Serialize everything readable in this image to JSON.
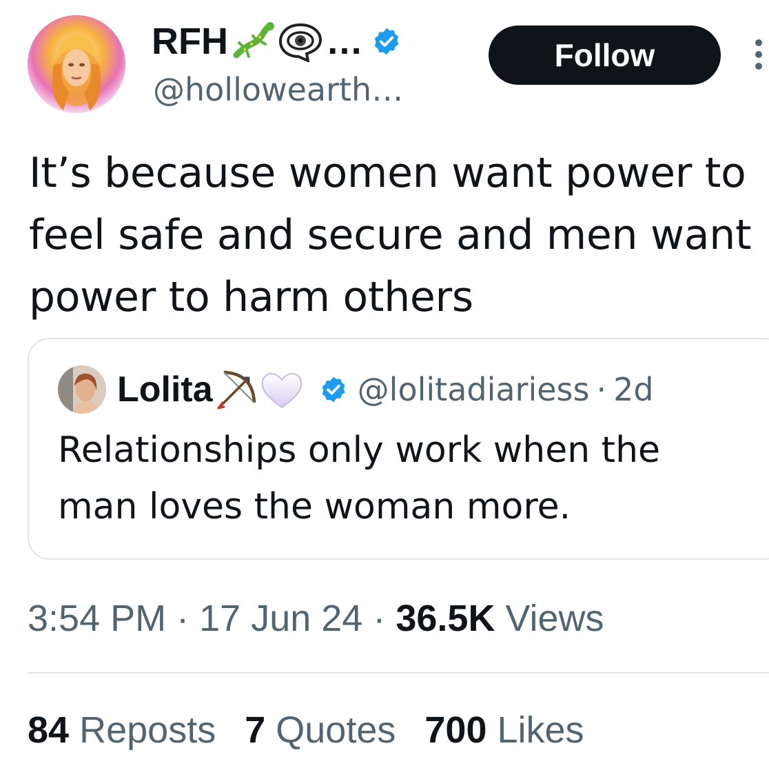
{
  "author": {
    "name": "RFH",
    "name_suffix": "…",
    "handle": "@hollowearth…",
    "verified": true
  },
  "follow_label": "Follow",
  "tweet_text": "It’s because women want power to feel safe and secure and men want power to harm others",
  "quote": {
    "name": "Lolita",
    "handle": "@lolitadiariess",
    "separator": "·",
    "age": "2d",
    "text": "Relationships only work when the man loves the woman more."
  },
  "meta": {
    "time": "3:54 PM",
    "sep1": "·",
    "date": "17 Jun 24",
    "sep2": "·",
    "views_count": "36.5K",
    "views_label": "Views"
  },
  "stats": {
    "reposts_count": "84",
    "reposts_label": "Reposts",
    "quotes_count": "7",
    "quotes_label": "Quotes",
    "likes_count": "700",
    "likes_label": "Likes"
  },
  "colors": {
    "text": "#0f1419",
    "secondary": "#536471",
    "verified_blue": "#1d9bf0",
    "follow_bg": "#0f1419",
    "border": "#dfe3e6"
  },
  "icons": [
    "lizard-emoji",
    "eye-speech-bubble-emoji",
    "verified-badge-icon",
    "more-options-icon",
    "bow-and-arrow-emoji",
    "white-heart-emoji"
  ]
}
